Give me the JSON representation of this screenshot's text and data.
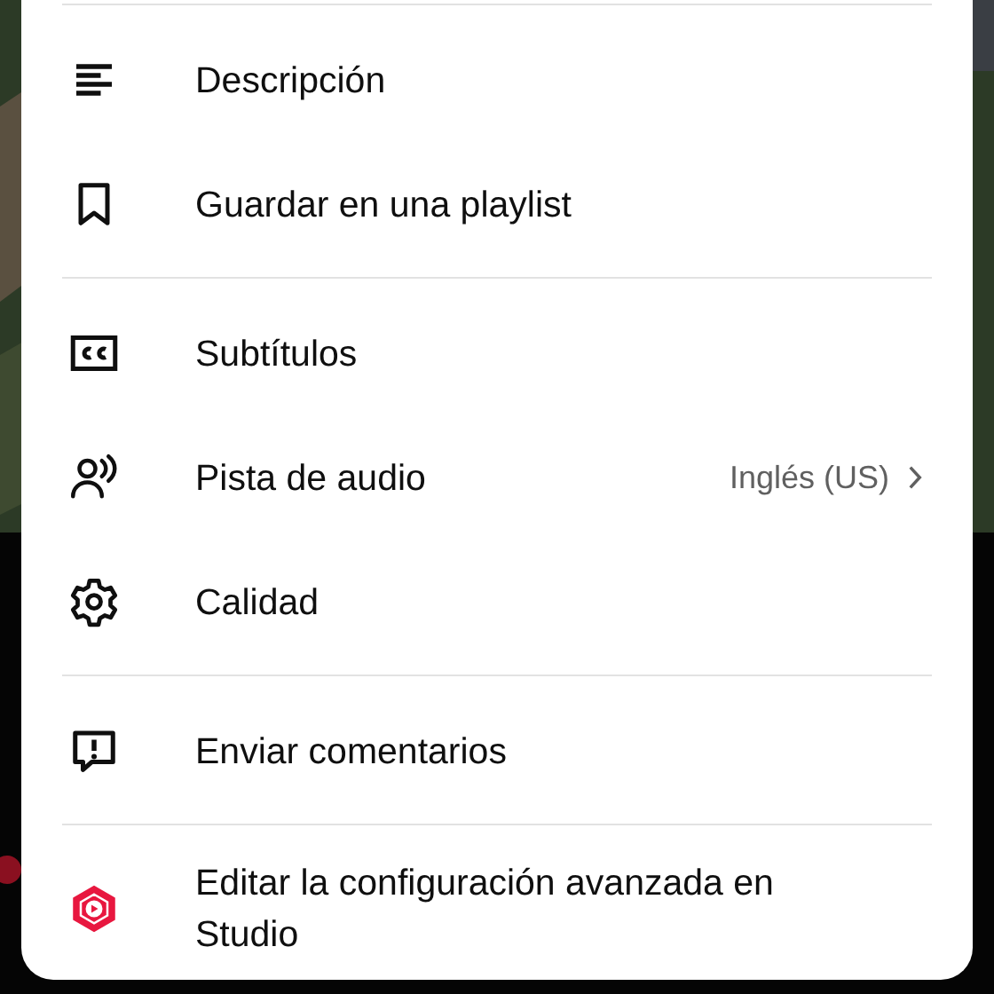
{
  "menu": {
    "sections": [
      {
        "items": [
          {
            "label": "Descripción"
          },
          {
            "label": "Guardar en una playlist"
          }
        ]
      },
      {
        "items": [
          {
            "label": "Subtítulos"
          },
          {
            "label": "Pista de audio",
            "value": "Inglés (US)"
          },
          {
            "label": "Calidad"
          }
        ]
      },
      {
        "items": [
          {
            "label": "Enviar comentarios"
          }
        ]
      },
      {
        "items": [
          {
            "label": "Editar la configuración avanzada en Studio"
          }
        ]
      }
    ]
  }
}
